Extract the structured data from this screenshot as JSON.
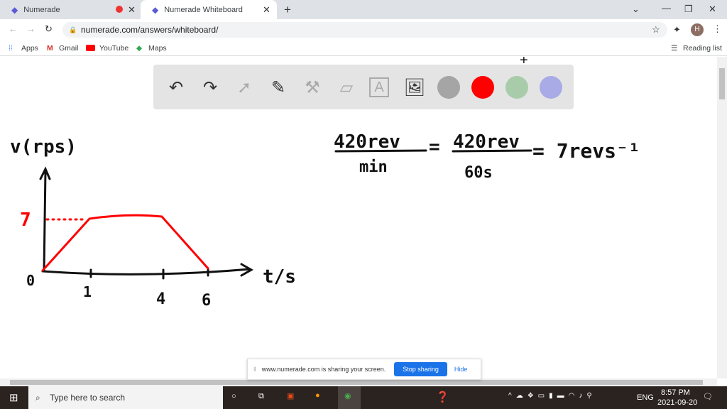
{
  "browser": {
    "tabs": [
      {
        "title": "Numerade"
      },
      {
        "title": "Numerade Whiteboard"
      }
    ],
    "url": "numerade.com/answers/whiteboard/",
    "bookmarks": [
      "Apps",
      "Gmail",
      "YouTube",
      "Maps"
    ],
    "reading_list": "Reading list",
    "profile_initial": "H"
  },
  "toolbar": {
    "icons": [
      "undo-icon",
      "redo-icon",
      "select-icon",
      "pen-icon",
      "tools-icon",
      "eraser-icon",
      "text-icon",
      "image-icon"
    ],
    "colors": [
      "#a5a5a5",
      "#ff0000",
      "#a8ccaa",
      "#a9abe6"
    ]
  },
  "whiteboard": {
    "y_label": "v(rps)",
    "x_label": "t/s",
    "y_tick": "7",
    "origin": "0",
    "x_ticks": [
      "1",
      "4",
      "6"
    ],
    "equation": {
      "num1": "420rev",
      "den1": "min",
      "num2": "420rev",
      "den2": "60s",
      "result": "= 7revs⁻¹"
    }
  },
  "share_bar": {
    "message": "www.numerade.com is sharing your screen.",
    "stop": "Stop sharing",
    "hide": "Hide"
  },
  "taskbar": {
    "search_placeholder": "Type here to search",
    "lang": "ENG",
    "time": "8:57 PM",
    "date": "2021-09-20"
  }
}
